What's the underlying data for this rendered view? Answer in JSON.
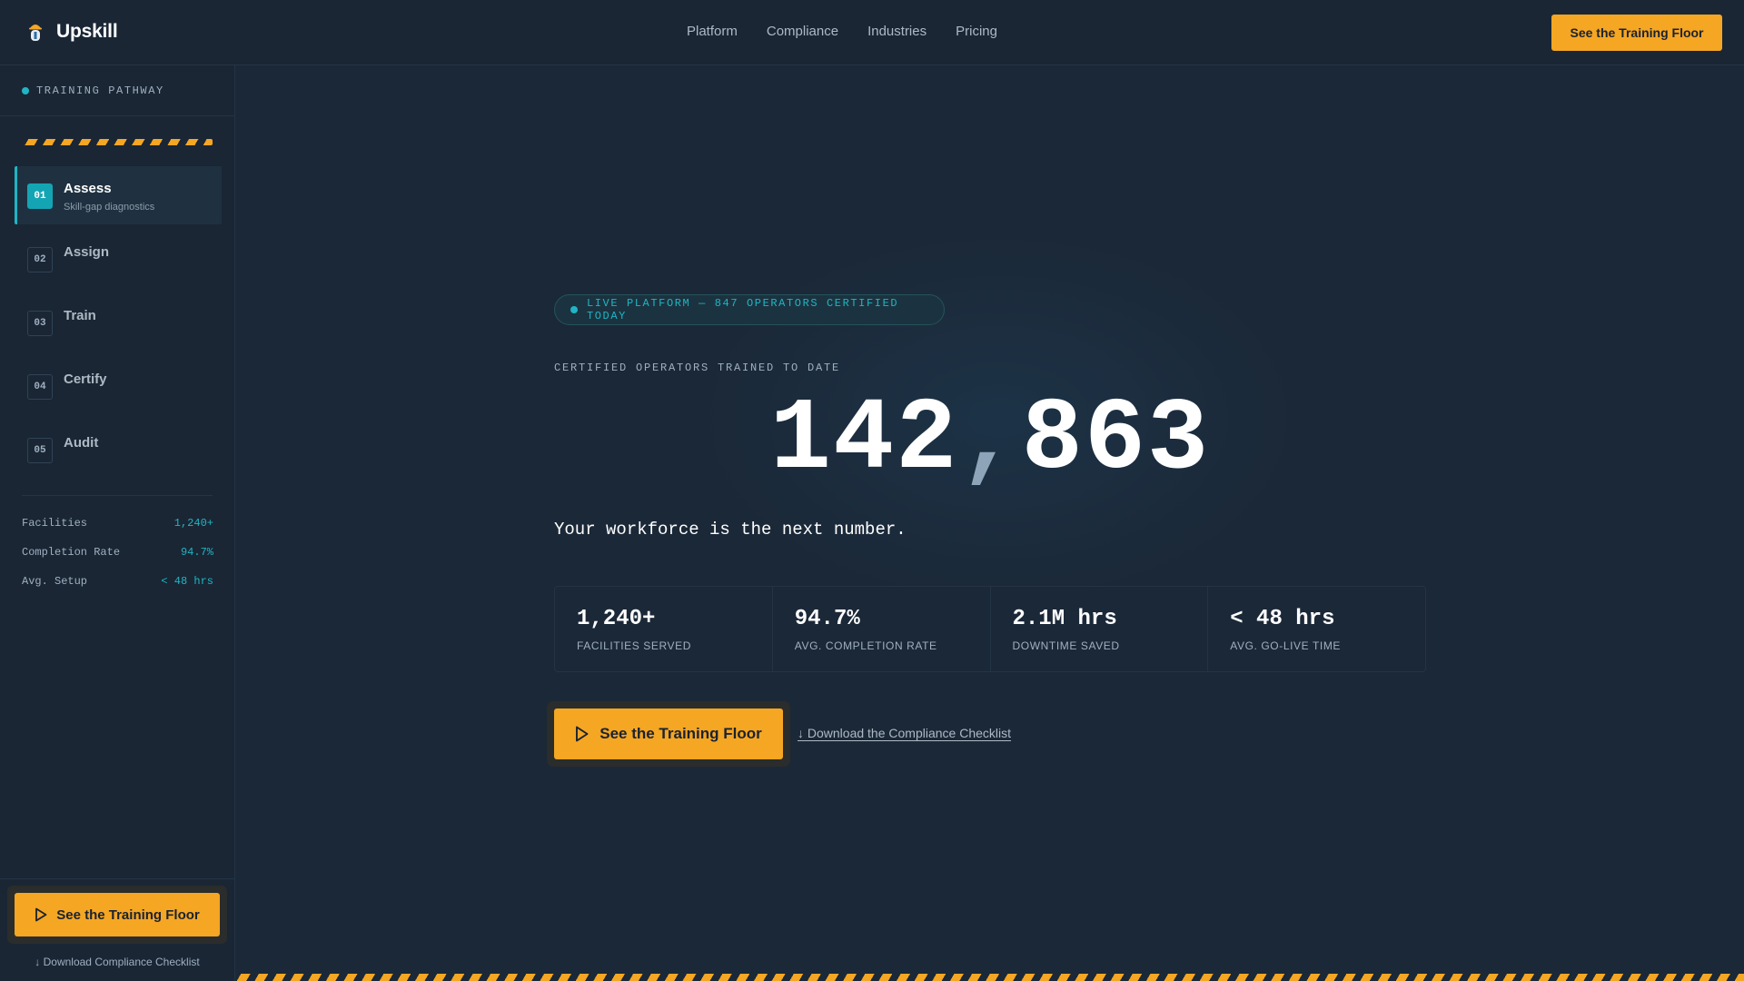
{
  "brand": {
    "name": "Upskill",
    "icon": "operator-helmet-icon"
  },
  "nav": {
    "items": [
      "Platform",
      "Compliance",
      "Industries",
      "Pricing"
    ],
    "cta_label": "See the Training Floor"
  },
  "sidebar": {
    "title": "TRAINING PATHWAY",
    "steps": [
      {
        "num": "01",
        "label": "Assess",
        "sub": "Skill-gap diagnostics",
        "active": true
      },
      {
        "num": "02",
        "label": "Assign"
      },
      {
        "num": "03",
        "label": "Train"
      },
      {
        "num": "04",
        "label": "Certify"
      },
      {
        "num": "05",
        "label": "Audit"
      }
    ],
    "metrics": [
      {
        "key": "Facilities",
        "value": "1,240+"
      },
      {
        "key": "Completion Rate",
        "value": "94.7%"
      },
      {
        "key": "Avg. Setup",
        "value": "< 48 hrs"
      }
    ],
    "cta_label": "See the Training Floor",
    "download_label": "↓ Download Compliance Checklist"
  },
  "hero": {
    "badge": "LIVE PLATFORM — 847 OPERATORS CERTIFIED TODAY",
    "overline": "CERTIFIED OPERATORS TRAINED TO DATE",
    "counter_head": "142",
    "counter_sep": ",",
    "counter_tail": "863",
    "tagline": "Your workforce is the next number.",
    "stats": [
      {
        "value": "1,240+",
        "label": "FACILITIES SERVED"
      },
      {
        "value": "94.7%",
        "label": "AVG. COMPLETION RATE"
      },
      {
        "value": "2.1M hrs",
        "label": "DOWNTIME SAVED"
      },
      {
        "value": "< 48 hrs",
        "label": "AVG. GO-LIVE TIME"
      }
    ],
    "cta_label": "See the Training Floor",
    "download_label": "↓ Download the Compliance Checklist"
  },
  "colors": {
    "accent": "#f5a623",
    "teal": "#1fb5c4",
    "background": "#1b2837"
  }
}
